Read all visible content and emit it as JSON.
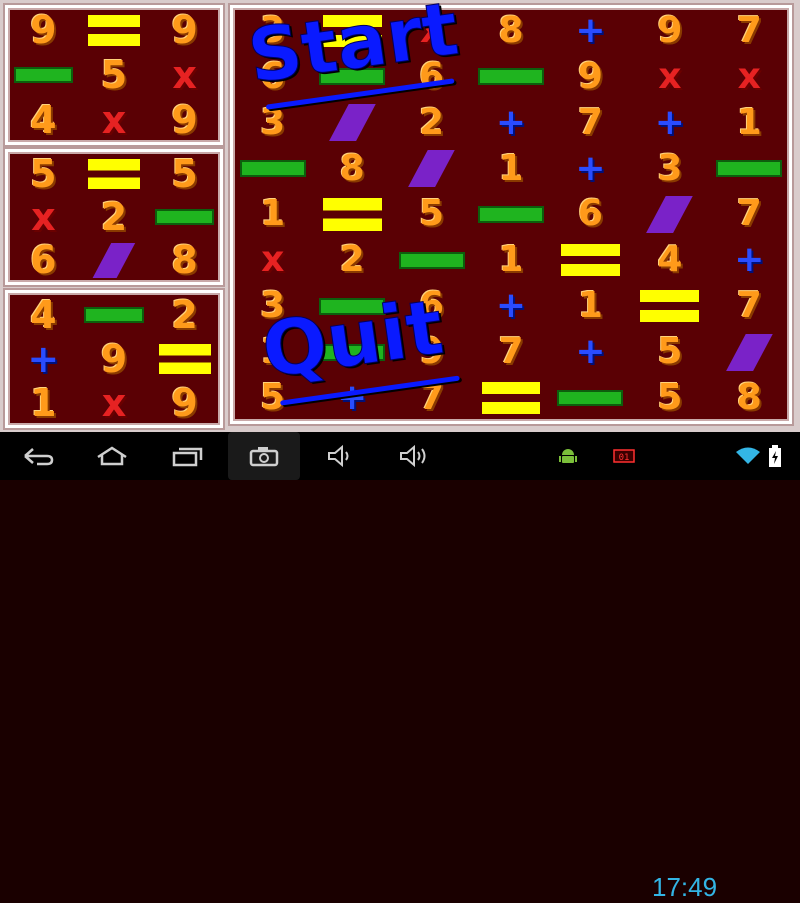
{
  "menu": {
    "start_label": "Start",
    "quit_label": "Quit"
  },
  "panel_left_top": [
    "9",
    "=",
    "9",
    "-",
    "5",
    "x",
    "4",
    "x",
    "9"
  ],
  "panel_left_mid": [
    "5",
    "=",
    "5",
    "x",
    "2",
    "-",
    "6",
    "/",
    "8"
  ],
  "panel_left_bot": [
    "4",
    "-",
    "2",
    "+",
    "9",
    "=",
    "1",
    "x",
    "9"
  ],
  "panel_big": [
    "3",
    "=",
    "x",
    "8",
    "+",
    "9",
    "7",
    "6",
    "-",
    "6",
    "-",
    "9",
    "x",
    "x",
    "3",
    "/",
    "2",
    "+",
    "7",
    "+",
    "1",
    "-",
    "8",
    "/",
    "1",
    "+",
    "3",
    "-",
    "1",
    "=",
    "5",
    "-",
    "6",
    "/",
    "7",
    "x",
    "2",
    "-",
    "1",
    "=",
    "4",
    "+",
    "3",
    "-",
    "6",
    "+",
    "1",
    "=",
    "7",
    "1",
    "-",
    "9",
    "7",
    "+",
    "5",
    "/",
    "5",
    "+",
    "7",
    "=",
    "-",
    "5",
    "8"
  ],
  "status_bar": {
    "time": "17:49"
  },
  "icons": {
    "back": "back-arrow-icon",
    "home": "home-icon",
    "recent": "recent-apps-icon",
    "screenshot": "camera-icon",
    "vol_down": "volume-down-icon",
    "vol_up": "volume-up-icon",
    "android": "android-icon",
    "battery_widget": "battery-widget-icon",
    "wifi": "wifi-icon",
    "battery": "battery-charging-icon"
  },
  "colors": {
    "digit": "#ff9a1a",
    "minus": "#1fb41f",
    "equals": "#ffff00",
    "divide": "#7a22c8",
    "times": "#e62222",
    "plus": "#2a4cff",
    "menu_text": "#0a1aff",
    "clock": "#33b5e5"
  }
}
